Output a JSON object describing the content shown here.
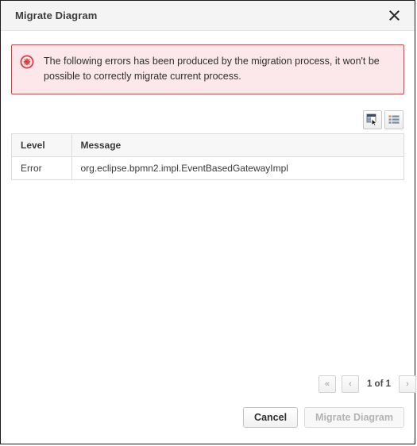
{
  "dialog": {
    "title": "Migrate Diagram",
    "close_icon": "close-icon"
  },
  "alert": {
    "icon": "error-circle-icon",
    "message": "The following errors has been produced by the migration process, it won't be possible to correctly migrate current process.",
    "border_color": "#e03c44",
    "background_color": "#fce8ea",
    "icon_color": "#e03c44"
  },
  "toolbar": {
    "buttons": [
      {
        "name": "select-columns-icon",
        "title": ""
      },
      {
        "name": "list-view-icon",
        "title": ""
      }
    ]
  },
  "table": {
    "columns": [
      "Level",
      "Message"
    ],
    "rows": [
      {
        "level": "Error",
        "message": "org.eclipse.bpmn2.impl.EventBasedGatewayImpl"
      }
    ]
  },
  "pagination": {
    "first_label": "«",
    "prev_label": "‹",
    "status": "1 of 1",
    "next_label": "›"
  },
  "footer": {
    "cancel_label": "Cancel",
    "migrate_label": "Migrate Diagram"
  }
}
